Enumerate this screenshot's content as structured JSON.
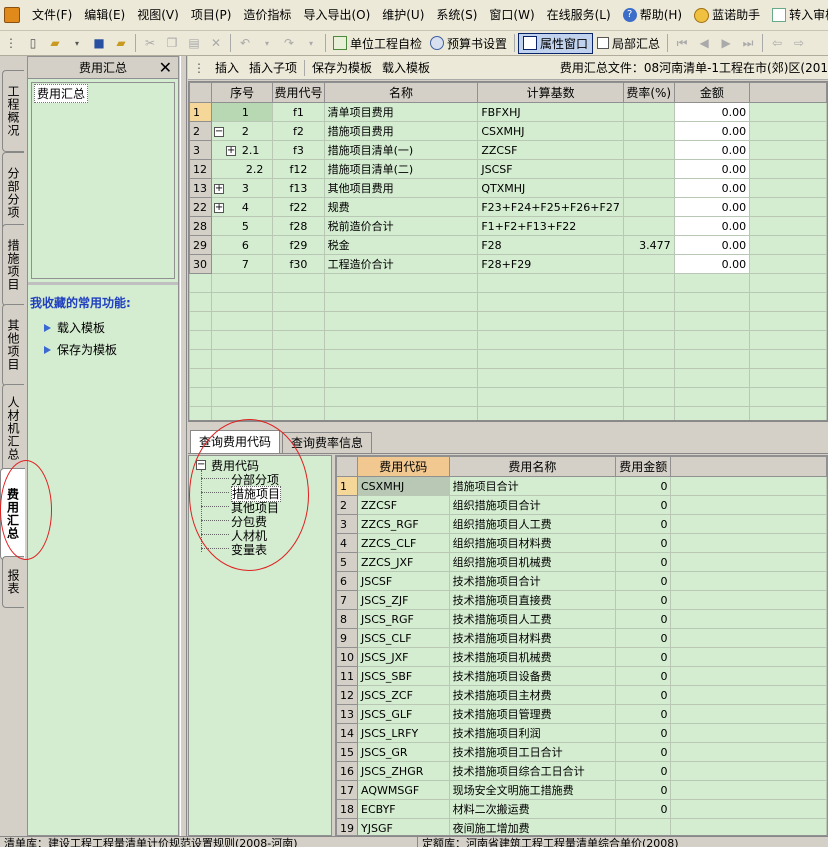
{
  "menubar": {
    "items": [
      "文件(F)",
      "编辑(E)",
      "视图(V)",
      "项目(P)",
      "造价指标",
      "导入导出(O)",
      "维护(U)",
      "系统(S)",
      "窗口(W)",
      "在线服务(L)"
    ],
    "help": "帮助(H)",
    "assistant": "蓝诺助手",
    "review": "转入审核"
  },
  "toolbar": {
    "self_check": "单位工程自检",
    "budget_settings": "预算书设置",
    "property_window": "属性窗口",
    "partial_summary": "局部汇总"
  },
  "vtabs": [
    "工程概况",
    "分部分项",
    "措施项目",
    "其他项目",
    "人材机汇总",
    "费用汇总",
    "报表"
  ],
  "left_panel": {
    "title": "费用汇总",
    "tree_item": "费用汇总",
    "favorites_title": "我收藏的常用功能:",
    "favorites": [
      "载入模板",
      "保存为模板"
    ]
  },
  "right_toolbar": {
    "buttons": [
      "插入",
      "插入子项",
      "保存为模板",
      "载入模板"
    ],
    "file_label": "费用汇总文件：08河南清单-1工程在市(郊)区(201"
  },
  "top_grid": {
    "headers": [
      "序号",
      "费用代号",
      "名称",
      "计算基数",
      "费率(%)",
      "金额"
    ],
    "rows": [
      {
        "row": "1",
        "seq": "1",
        "code": "f1",
        "name": "清单项目费用",
        "base": "FBFXHJ",
        "rate": "",
        "amount": "0.00",
        "expand": "",
        "selected": true
      },
      {
        "row": "2",
        "seq": "2",
        "code": "f2",
        "name": "措施项目费用",
        "base": "CSXMHJ",
        "rate": "",
        "amount": "0.00",
        "expand": "−"
      },
      {
        "row": "3",
        "seq": "2.1",
        "code": "f3",
        "name": "措施项目清单(一)",
        "base": "ZZCSF",
        "rate": "",
        "amount": "0.00",
        "expand": "+"
      },
      {
        "row": "12",
        "seq": "2.2",
        "code": "f12",
        "name": "措施项目清单(二)",
        "base": "JSCSF",
        "rate": "",
        "amount": "0.00",
        "expand": ""
      },
      {
        "row": "13",
        "seq": "3",
        "code": "f13",
        "name": "其他项目费用",
        "base": "QTXMHJ",
        "rate": "",
        "amount": "0.00",
        "expand": "+"
      },
      {
        "row": "22",
        "seq": "4",
        "code": "f22",
        "name": "规费",
        "base": "F23+F24+F25+F26+F27",
        "rate": "",
        "amount": "0.00",
        "expand": "+"
      },
      {
        "row": "28",
        "seq": "5",
        "code": "f28",
        "name": "税前造价合计",
        "base": "F1+F2+F13+F22",
        "rate": "",
        "amount": "0.00",
        "expand": ""
      },
      {
        "row": "29",
        "seq": "6",
        "code": "f29",
        "name": "税金",
        "base": "F28",
        "rate": "3.477",
        "amount": "0.00",
        "expand": ""
      },
      {
        "row": "30",
        "seq": "7",
        "code": "f30",
        "name": "工程造价合计",
        "base": "F28+F29",
        "rate": "",
        "amount": "0.00",
        "expand": ""
      }
    ]
  },
  "bottom_tabs": [
    "查询费用代码",
    "查询费率信息"
  ],
  "code_tree": {
    "root": "费用代码",
    "children": [
      "分部分项",
      "措施项目",
      "其他项目",
      "分包费",
      "人材机",
      "变量表"
    ],
    "selected_index": 1
  },
  "code_grid": {
    "headers": [
      "费用代码",
      "费用名称",
      "费用金额"
    ],
    "rows": [
      {
        "n": "1",
        "code": "CSXMHJ",
        "name": "措施项目合计",
        "amount": "0"
      },
      {
        "n": "2",
        "code": "ZZCSF",
        "name": "组织措施项目合计",
        "amount": "0"
      },
      {
        "n": "3",
        "code": "ZZCS_RGF",
        "name": "组织措施项目人工费",
        "amount": "0"
      },
      {
        "n": "4",
        "code": "ZZCS_CLF",
        "name": "组织措施项目材料费",
        "amount": "0"
      },
      {
        "n": "5",
        "code": "ZZCS_JXF",
        "name": "组织措施项目机械费",
        "amount": "0"
      },
      {
        "n": "6",
        "code": "JSCSF",
        "name": "技术措施项目合计",
        "amount": "0"
      },
      {
        "n": "7",
        "code": "JSCS_ZJF",
        "name": "技术措施项目直接费",
        "amount": "0"
      },
      {
        "n": "8",
        "code": "JSCS_RGF",
        "name": "技术措施项目人工费",
        "amount": "0"
      },
      {
        "n": "9",
        "code": "JSCS_CLF",
        "name": "技术措施项目材料费",
        "amount": "0"
      },
      {
        "n": "10",
        "code": "JSCS_JXF",
        "name": "技术措施项目机械费",
        "amount": "0"
      },
      {
        "n": "11",
        "code": "JSCS_SBF",
        "name": "技术措施项目设备费",
        "amount": "0"
      },
      {
        "n": "12",
        "code": "JSCS_ZCF",
        "name": "技术措施项目主材费",
        "amount": "0"
      },
      {
        "n": "13",
        "code": "JSCS_GLF",
        "name": "技术措施项目管理费",
        "amount": "0"
      },
      {
        "n": "14",
        "code": "JSCS_LRFY",
        "name": "技术措施项目利润",
        "amount": "0"
      },
      {
        "n": "15",
        "code": "JSCS_GR",
        "name": "技术措施项目工日合计",
        "amount": "0"
      },
      {
        "n": "16",
        "code": "JSCS_ZHGR",
        "name": "技术措施项目综合工日合计",
        "amount": "0"
      },
      {
        "n": "17",
        "code": "AQWMSGF",
        "name": "现场安全文明施工措施费",
        "amount": "0"
      },
      {
        "n": "18",
        "code": "ECBYF",
        "name": "材料二次搬运费",
        "amount": "0"
      },
      {
        "n": "19",
        "code": "YJSGF",
        "name": "夜间施工增加费",
        "amount": ""
      }
    ]
  },
  "statusbar": {
    "left": "清单库：建设工程工程量清单计价规范设置规则(2008-河南)",
    "right": "定额库：河南省建筑工程工程量清单综合单价(2008)"
  }
}
